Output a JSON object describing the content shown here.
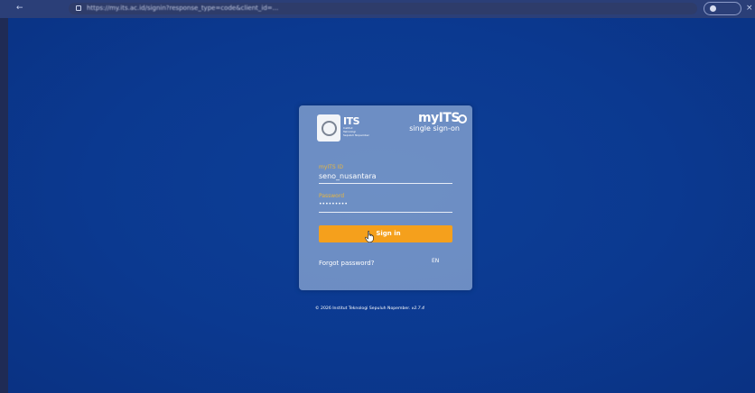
{
  "browser": {
    "nav_arrow": "←",
    "close": "×",
    "url": "https://my.its.ac.id/signin?response_type=code&client_id=..."
  },
  "login": {
    "its_wordmark": "ITS",
    "its_tagline": "Institut\nTeknologi\nSepuluh Nopember",
    "myits_logo": "myITS",
    "myits_subtitle": "single sign-on",
    "id_label": "myITS ID",
    "id_value": "seno_nusantara",
    "password_label": "Password",
    "password_value": "•••••••••",
    "signin_label": "Sign in",
    "forgot_label": "Forgot password?",
    "language": "EN"
  },
  "footer": {
    "copyright": "© 2026 Institut Teknologi Sepuluh Nopember.",
    "version": "v2.7.4"
  },
  "colors": {
    "background": "#0b3990",
    "accent": "#f5a01c",
    "label": "#e8b640"
  },
  "icons": {
    "emblem": "its-emblem-icon",
    "cursor": "hand-pointer-icon",
    "lock": "lock-icon"
  }
}
